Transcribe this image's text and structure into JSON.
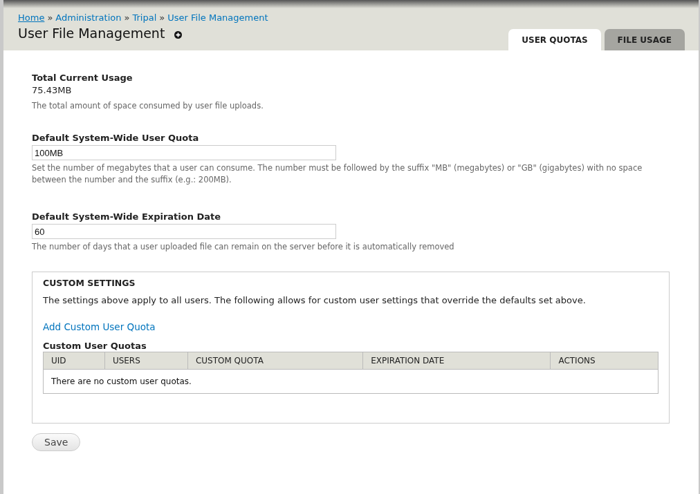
{
  "breadcrumb": [
    {
      "kind": "link",
      "label": "Home",
      "underlined": true
    },
    {
      "kind": "separator",
      "label": "»"
    },
    {
      "kind": "link",
      "label": "Administration",
      "underlined": false
    },
    {
      "kind": "separator",
      "label": "»"
    },
    {
      "kind": "link",
      "label": "Tripal",
      "underlined": false
    },
    {
      "kind": "separator",
      "label": "»"
    },
    {
      "kind": "link",
      "label": "User File Management",
      "underlined": false
    }
  ],
  "page_title": "User File Management",
  "tabs": [
    {
      "label": "USER QUOTAS",
      "selected": true
    },
    {
      "label": "FILE USAGE",
      "selected": false
    }
  ],
  "usage": {
    "label": "Total Current Usage",
    "value": "75.43MB",
    "description": "The total amount of space consumed by user file uploads."
  },
  "fields": [
    {
      "label": "Default System-Wide User Quota",
      "value": "100MB",
      "description": "Set the number of megabytes that a user can consume. The number must be followed by the suffix \"MB\" (megabytes) or \"GB\" (gigabytes) with no space between the number and the suffix (e.g.: 200MB)."
    },
    {
      "label": "Default System-Wide Expiration Date",
      "value": "60",
      "description": "The number of days that a user uploaded file can remain on the server before it is automatically removed"
    }
  ],
  "custom_settings": {
    "legend": "CUSTOM SETTINGS",
    "description": "The settings above apply to all users. The following allows for custom user settings that override the defaults set above.",
    "add_link": "Add Custom User Quota",
    "table_title": "Custom User Quotas",
    "table": {
      "columns": [
        "UID",
        "USERS",
        "CUSTOM QUOTA",
        "EXPIRATION DATE",
        "ACTIONS"
      ],
      "empty_message": "There are no custom user quotas."
    }
  },
  "buttons": [
    "Save"
  ]
}
